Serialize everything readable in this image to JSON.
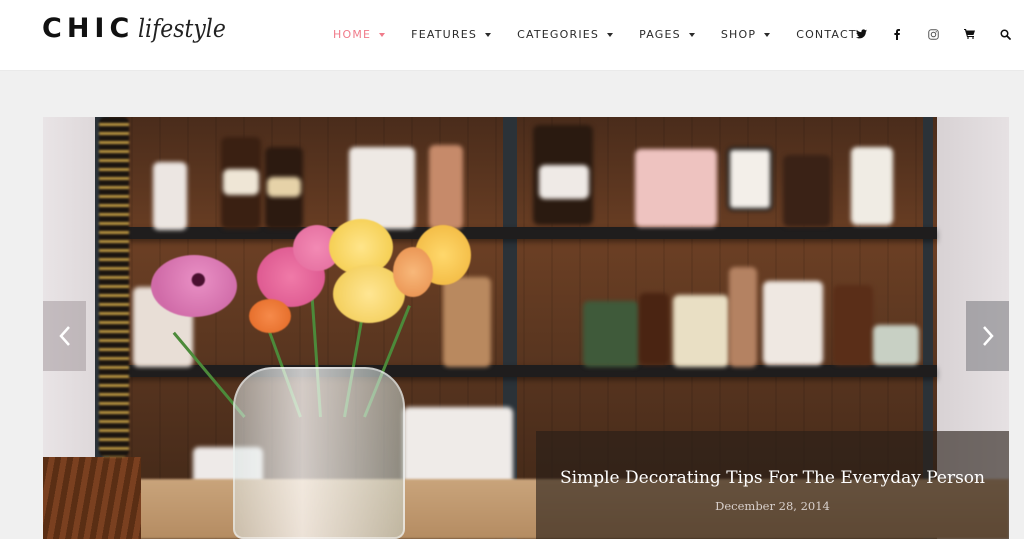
{
  "header": {
    "logo_main": "CHIC",
    "logo_sub": "lifestyle"
  },
  "nav": {
    "items": [
      {
        "label": "HOME",
        "has_dropdown": true,
        "active": true
      },
      {
        "label": "FEATURES",
        "has_dropdown": true,
        "active": false
      },
      {
        "label": "CATEGORIES",
        "has_dropdown": true,
        "active": false
      },
      {
        "label": "PAGES",
        "has_dropdown": true,
        "active": false
      },
      {
        "label": "SHOP",
        "has_dropdown": true,
        "active": false
      },
      {
        "label": "CONTACT",
        "has_dropdown": false,
        "active": false
      }
    ],
    "active_color": "#f07b8a"
  },
  "header_icons": [
    "twitter-icon",
    "facebook-icon",
    "instagram-icon",
    "cart-icon",
    "search-icon"
  ],
  "slider": {
    "slide_title": "Simple Decorating Tips For The Everyday Person",
    "slide_date": "December 28, 2014",
    "prev_icon": "chevron-left-icon",
    "next_icon": "chevron-right-icon"
  }
}
